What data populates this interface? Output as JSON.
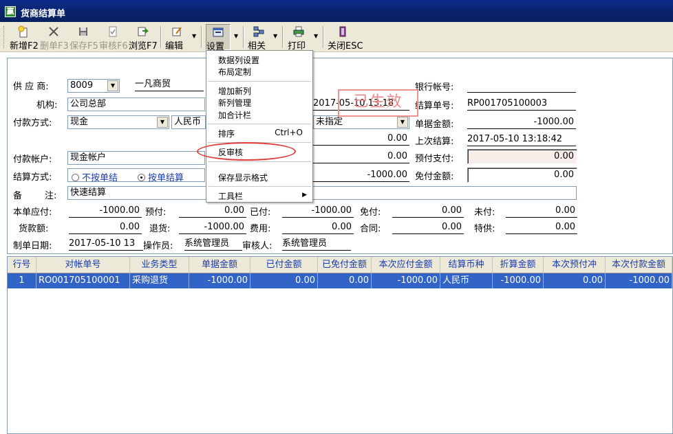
{
  "window": {
    "title": "货商结算单",
    "icon_char": "赢"
  },
  "toolbar": {
    "new": "新增F2",
    "delete": "删单F3",
    "save": "保存F5",
    "review": "审核F6",
    "browse": "浏览F7",
    "edit": "编辑",
    "settings": "设置",
    "related": "相关",
    "print": "打印",
    "close": "关闭ESC"
  },
  "form": {
    "supplier_label": "供 应 商:",
    "supplier_code": "8009",
    "supplier_name": "一凡商贸",
    "org_label": "机构:",
    "org_value": "公司总部",
    "paymethod_label": "付款方式:",
    "paymethod_value": "现金",
    "currency_value": "人民币",
    "date_partial": "2017-05-10 13:18",
    "unspecified_value": "未指定",
    "amount_mid1": "0.00",
    "amount_mid2": "0.00",
    "amount_mid3": "-1000.00",
    "account_label": "付款帐户:",
    "account_value": "现金帐户",
    "settle_mode_label": "结算方式:",
    "radio_not_single": "不按单结",
    "radio_single": "按单结算",
    "remark_label_a": "备",
    "remark_label_b": "注:",
    "remark_value": "快速结算",
    "bank_label": "银行帐号:",
    "bank_value": "",
    "settle_no_label": "结算单号:",
    "settle_no_value": "RP001705100003",
    "doc_amount_label": "单据金额:",
    "doc_amount_value": "-1000.00",
    "last_settle_label": "上次结算:",
    "last_settle_value": "2017-05-10 13:18:42",
    "prepay_label": "预付支付:",
    "prepay_value": "0.00",
    "free_pay_label": "免付金额:",
    "free_pay_value": "0.00",
    "stamp_text": "已生效"
  },
  "summary": {
    "payable_label": "本单应付:",
    "payable_value": "-1000.00",
    "prepaid_label": "预付:",
    "prepaid_value": "0.00",
    "paid_label": "已付:",
    "paid_value": "-1000.00",
    "free_label": "免付:",
    "free_value": "0.00",
    "unpaid_label": "未付:",
    "unpaid_value": "0.00",
    "goods_label": "货款额:",
    "goods_value": "0.00",
    "return_label": "退货:",
    "return_value": "-1000.00",
    "fee_label": "费用:",
    "fee_value": "0.00",
    "contract_label": "合同:",
    "contract_value": "0.00",
    "special_label": "特供:",
    "special_value": "0.00",
    "date_label": "制单日期:",
    "date_value": "2017-05-10 13",
    "operator_label": "操作员:",
    "operator_value": "系统管理员",
    "reviewer_label": "审核人:",
    "reviewer_value": "系统管理员"
  },
  "grid": {
    "headers": [
      "行号",
      "对帐单号",
      "业务类型",
      "单据金额",
      "已付金额",
      "已免付金额",
      "本次应付金额",
      "结算币种",
      "折算金额",
      "本次预付冲",
      "本次付款金额"
    ],
    "rows": [
      [
        "1",
        "RO001705100001",
        "采购退货",
        "-1000.00",
        "0.00",
        "0.00",
        "-1000.00",
        "人民币",
        "-1000.00",
        "0.00",
        "-1000.00"
      ]
    ]
  },
  "menu": {
    "items": [
      "数据列设置",
      "布局定制",
      "增加新列",
      "新列管理",
      "加合计栏",
      "排序",
      "反审核",
      "保存显示格式",
      "工具栏"
    ],
    "sort_shortcut": "Ctrl+O"
  },
  "colors": {
    "titlebar": "#0a246a",
    "selection": "#3164c6",
    "header_text": "#1a3ab0",
    "highlight_oval": "#e03a3a",
    "stamp": "#ee8888"
  }
}
